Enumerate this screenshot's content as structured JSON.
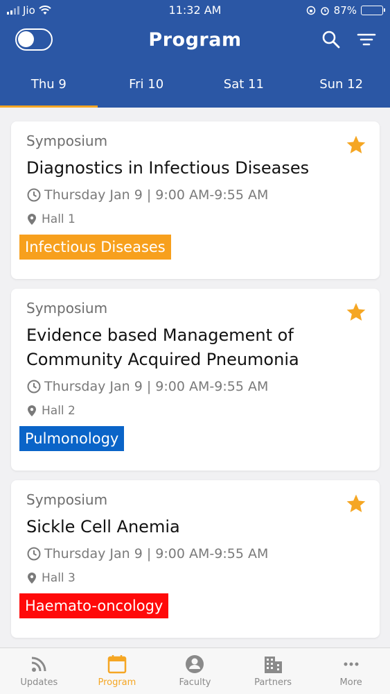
{
  "status_bar": {
    "carrier": "Jio",
    "time": "11:32 AM",
    "battery": "87%"
  },
  "header": {
    "title": "Program",
    "toggle_on": false,
    "background": "#2b57a5"
  },
  "tabs": [
    {
      "label": "Thu 9",
      "active": true
    },
    {
      "label": "Fri 10",
      "active": false
    },
    {
      "label": "Sat 11",
      "active": false
    },
    {
      "label": "Sun 12",
      "active": false
    }
  ],
  "sessions": [
    {
      "type": "Symposium",
      "title": "Diagnostics in Infectious Diseases",
      "time": "Thursday Jan 9 | 9:00 AM-9:55 AM",
      "hall": "Hall 1",
      "tag": "Infectious Diseases",
      "tag_color": "#f7a01d",
      "starred": true
    },
    {
      "type": "Symposium",
      "title": "Evidence based Management of Community Acquired Pneumonia",
      "time": "Thursday Jan 9 | 9:00 AM-9:55 AM",
      "hall": "Hall 2",
      "tag": "Pulmonology",
      "tag_color": "#0a64c8",
      "starred": true
    },
    {
      "type": "Symposium",
      "title": "Sickle Cell Anemia",
      "time": "Thursday Jan 9 | 9:00 AM-9:55 AM",
      "hall": "Hall 3",
      "tag": "Haemato-oncology",
      "tag_color": "#ff0a0a",
      "starred": true
    }
  ],
  "bottom_nav": [
    {
      "label": "Updates",
      "icon": "rss-icon",
      "active": false
    },
    {
      "label": "Program",
      "icon": "calendar-icon",
      "active": true
    },
    {
      "label": "Faculty",
      "icon": "person-icon",
      "active": false
    },
    {
      "label": "Partners",
      "icon": "building-icon",
      "active": false
    },
    {
      "label": "More",
      "icon": "more-dots-icon",
      "active": false
    }
  ],
  "colors": {
    "accent": "#f5a623",
    "star": "#f5a623"
  }
}
